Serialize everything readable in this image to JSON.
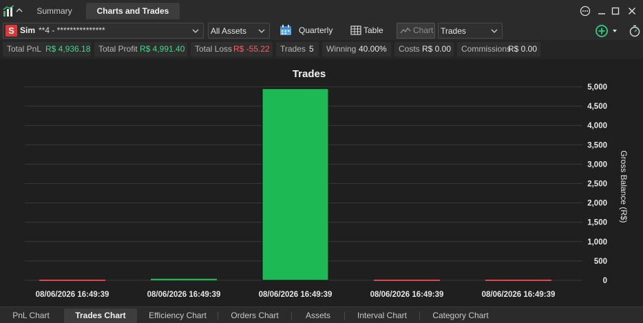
{
  "window": {
    "tabs": [
      {
        "label": "Summary",
        "active": false
      },
      {
        "label": "Charts and Trades",
        "active": true
      }
    ]
  },
  "toolbar": {
    "account_badge": "S",
    "account_name": "Sim",
    "account_number": "**4 - ***************",
    "assets_label": "All Assets",
    "period_label": "Quarterly",
    "table_label": "Table",
    "chart_label": "Chart",
    "view_label": "Trades"
  },
  "stats": [
    {
      "label": "Total PnL",
      "value": "R$ 4,936.18",
      "tone": "pos"
    },
    {
      "label": "Total Profit",
      "value": "R$ 4,991.40",
      "tone": "pos"
    },
    {
      "label": "Total Loss",
      "value": "R$ -55.22",
      "tone": "neg"
    },
    {
      "label": "Trades",
      "value": "5",
      "tone": "neu"
    },
    {
      "label": "Winning",
      "value": "40.00%",
      "tone": "neu"
    },
    {
      "label": "Costs",
      "value": "R$ 0.00",
      "tone": "neu"
    },
    {
      "label": "Commissions",
      "value": "R$ 0.00",
      "tone": "neu"
    }
  ],
  "chart_data": {
    "type": "bar",
    "title": "Trades",
    "ylabel": "Gross Balance (R$)",
    "xlabel": "",
    "categories": [
      "08/06/2026 16:49:39",
      "08/06/2026 16:49:39",
      "08/06/2026 16:49:39",
      "08/06/2026 16:49:39",
      "08/06/2026 16:49:39"
    ],
    "values": [
      -5,
      40,
      4951,
      -30,
      -20
    ],
    "ylim": [
      0,
      5000
    ],
    "yticks": [
      0,
      500,
      1000,
      1500,
      2000,
      2500,
      3000,
      3500,
      4000,
      4500,
      5000
    ],
    "ytick_labels": [
      "0",
      "500",
      "1,000",
      "1,500",
      "2,000",
      "2,500",
      "3,000",
      "3,500",
      "4,000",
      "4,500",
      "5,000"
    ],
    "grid": true,
    "colors": {
      "positive": "#1db954",
      "negative": "#e04848"
    }
  },
  "bottom_tabs": [
    {
      "label": "PnL Chart",
      "active": false
    },
    {
      "label": "Trades Chart",
      "active": true
    },
    {
      "label": "Efficiency Chart",
      "active": false
    },
    {
      "label": "Orders Chart",
      "active": false
    },
    {
      "label": "Assets",
      "active": false
    },
    {
      "label": "Interval Chart",
      "active": false
    },
    {
      "label": "Category Chart",
      "active": false
    }
  ]
}
